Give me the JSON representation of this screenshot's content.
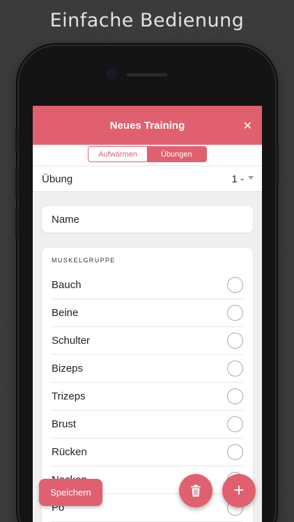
{
  "headline": "Einfache Bedienung",
  "nav": {
    "title": "Neues Training",
    "close": "✕"
  },
  "segments": [
    {
      "label": "Aufwärmen",
      "active": false
    },
    {
      "label": "Übungen",
      "active": true
    }
  ],
  "uebung": {
    "label": "Übung",
    "value": "1 -"
  },
  "name_field": {
    "value": "Name"
  },
  "muscle": {
    "header": "MUSKELGRUPPE",
    "items": [
      {
        "label": "Bauch"
      },
      {
        "label": "Beine"
      },
      {
        "label": "Schulter"
      },
      {
        "label": "Bizeps"
      },
      {
        "label": "Trizeps"
      },
      {
        "label": "Brust"
      },
      {
        "label": "Rücken"
      },
      {
        "label": "Nacken"
      },
      {
        "label": "Po"
      }
    ]
  },
  "actions": {
    "save_label": "Speichern",
    "trash_icon": "trash-icon",
    "add_icon": "plus-icon",
    "add_glyph": "+"
  },
  "colors": {
    "accent": "#e0606f",
    "background": "#efeff0"
  }
}
